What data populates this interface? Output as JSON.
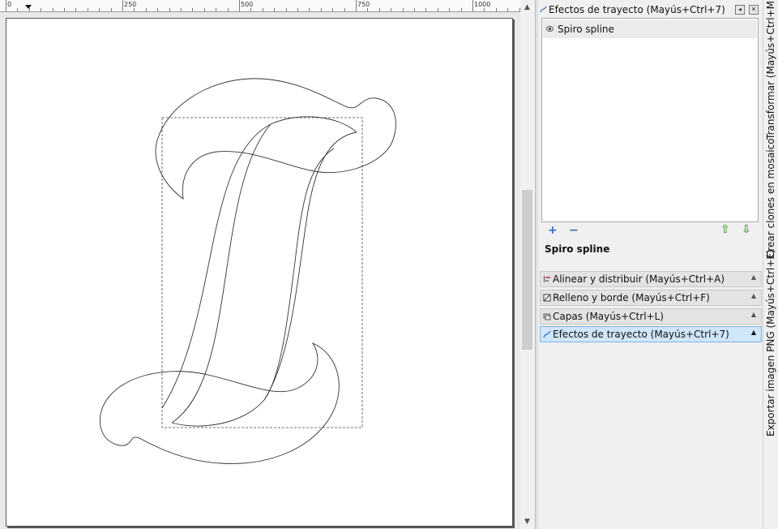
{
  "ruler": {
    "labels": [
      "0",
      "250",
      "500",
      "750",
      "1000"
    ]
  },
  "lpe_dialog": {
    "title": "Efectos de trayecto (Mayús+Ctrl+7)",
    "effects": [
      {
        "label": "Spiro spline"
      }
    ],
    "current_effect_name": "Spiro spline",
    "buttons": {
      "add": "+",
      "remove": "−",
      "move_up": "⇧",
      "move_down": "⇩"
    }
  },
  "dock_tabs": [
    {
      "label": "Alinear y distribuir (Mayús+Ctrl+A)",
      "icon": "align-icon"
    },
    {
      "label": "Relleno y borde (Mayús+Ctrl+F)",
      "icon": "fill-stroke-icon"
    },
    {
      "label": "Capas (Mayús+Ctrl+L)",
      "icon": "layers-icon"
    },
    {
      "label": "Efectos de trayecto (Mayús+Ctrl+7)",
      "icon": "path-effects-icon"
    }
  ],
  "side_tabs": [
    {
      "label": "Transformar (Mayús+Ctrl+M)"
    },
    {
      "label": "Crear clones en mosaico"
    },
    {
      "label": "Exportar imagen PNG (Mayús+Ctrl+E)"
    }
  ],
  "colors": {
    "active_tab": "#cfe6fb",
    "accent_green": "#4aa83a",
    "accent_blue": "#2f6cc0"
  }
}
